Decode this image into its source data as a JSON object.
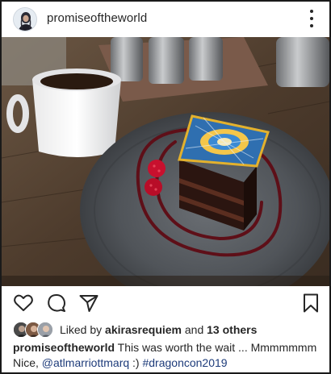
{
  "header": {
    "username": "promiseoftheworld",
    "avatar_icon": "profile-avatar",
    "more_icon": "more-options-vertical-icon"
  },
  "photo": {
    "subject_icon": "dessert-photo"
  },
  "actions": {
    "like_icon": "heart-icon",
    "comment_icon": "comment-bubble-icon",
    "share_icon": "paper-plane-icon",
    "save_icon": "bookmark-icon"
  },
  "likes": {
    "prefix": "Liked by",
    "user": "akirasrequiem",
    "joiner": "and",
    "others": "13 others"
  },
  "caption": {
    "username": "promiseoftheworld",
    "text_line1": "This was worth the wait ... Mmmmmmm",
    "text_line2_start": "Nice, ",
    "mention": "@atlmarriottmarq",
    "smiley": " :) ",
    "hashtag": "#dragoncon2019"
  }
}
